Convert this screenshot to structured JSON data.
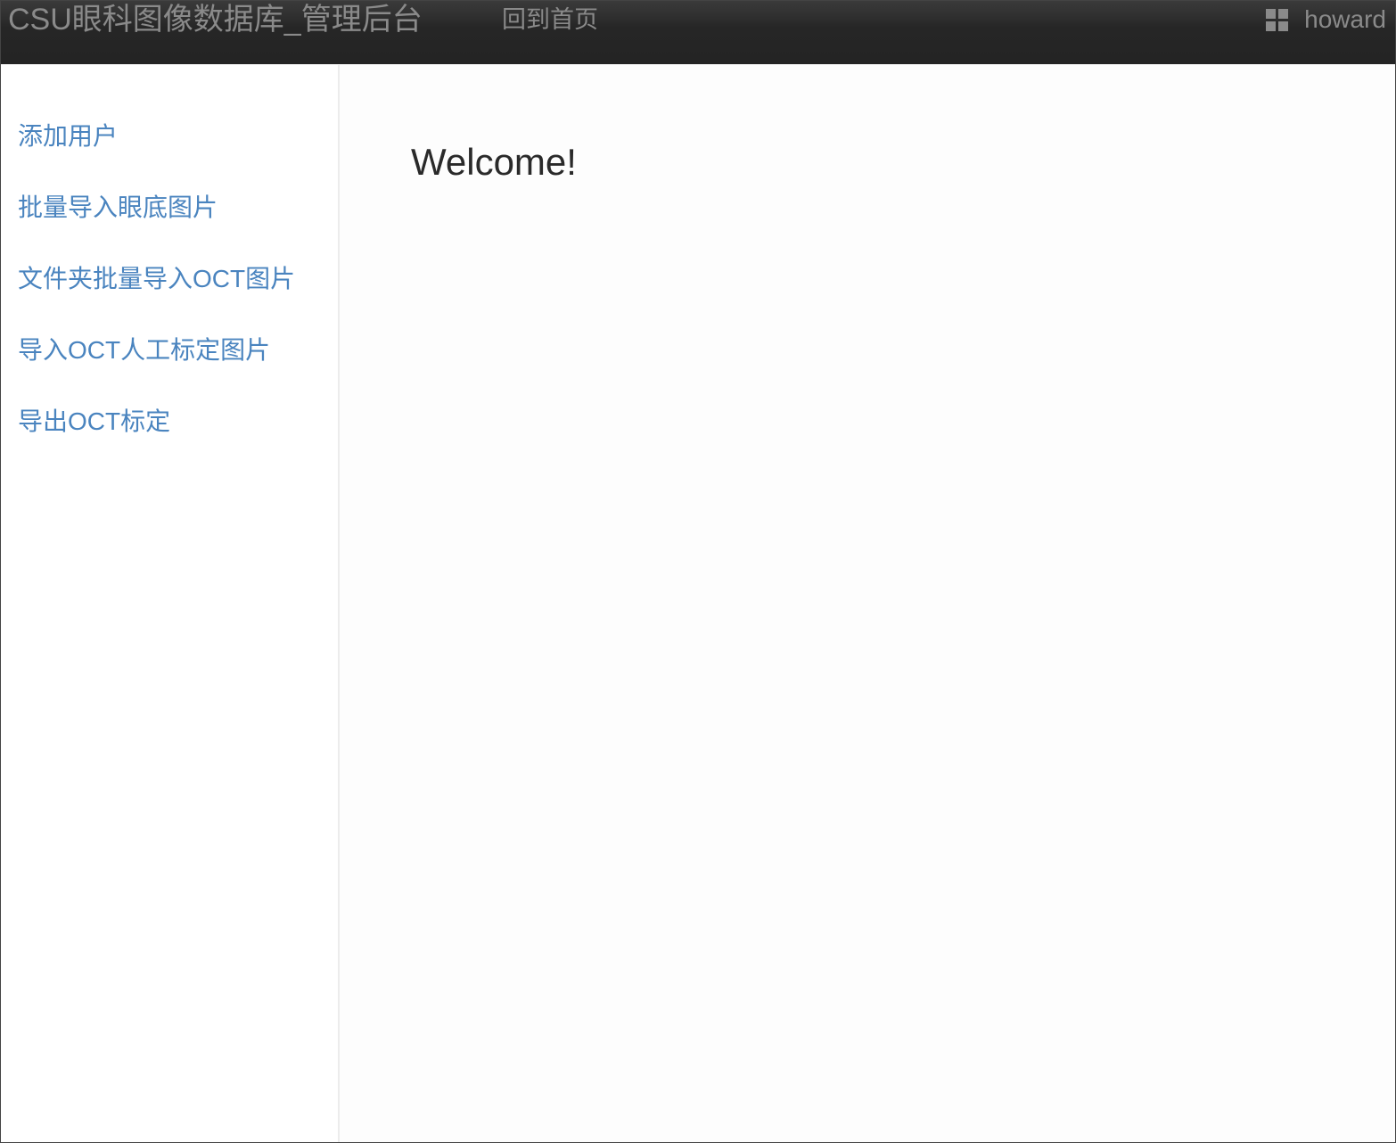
{
  "header": {
    "brand": "CSU眼科图像数据库_管理后台",
    "home_link": "回到首页",
    "user_icon": "grid-icon",
    "username": "howard"
  },
  "sidebar": {
    "items": [
      {
        "label": "添加用户"
      },
      {
        "label": "批量导入眼底图片"
      },
      {
        "label": "文件夹批量导入OCT图片"
      },
      {
        "label": "导入OCT人工标定图片"
      },
      {
        "label": "导出OCT标定"
      }
    ]
  },
  "main": {
    "heading": "Welcome!"
  },
  "colors": {
    "navbar": "#242424",
    "nav_text": "#8a8a8a",
    "link": "#4a84bf",
    "heading": "#2a2a2a"
  }
}
